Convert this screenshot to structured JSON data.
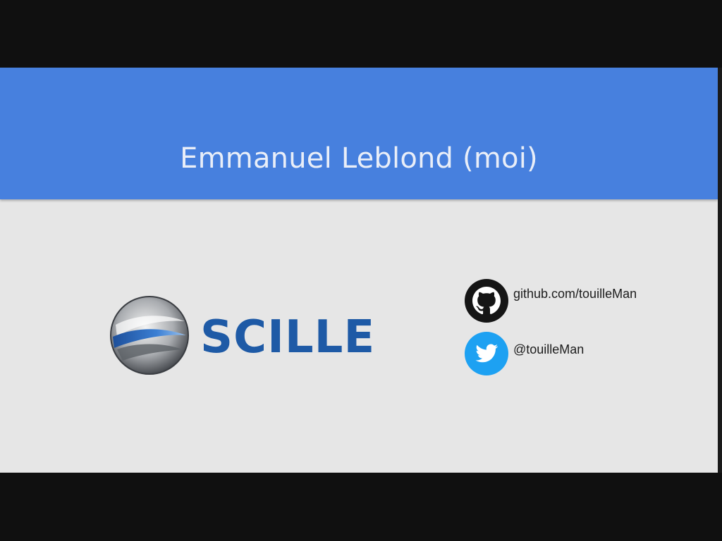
{
  "slide": {
    "title": "Emmanuel Leblond (moi)"
  },
  "logo": {
    "text": "SCILLE",
    "icon": "scille-sphere-icon",
    "color": "#1e5aa6"
  },
  "social": {
    "github": {
      "icon": "github-icon",
      "text": "github.com/touilleMan"
    },
    "twitter": {
      "icon": "twitter-icon",
      "text": "@touilleMan",
      "color": "#1da1f2"
    }
  },
  "colors": {
    "header": "#4780de",
    "background": "#e6e6e6",
    "frame": "#101010"
  }
}
